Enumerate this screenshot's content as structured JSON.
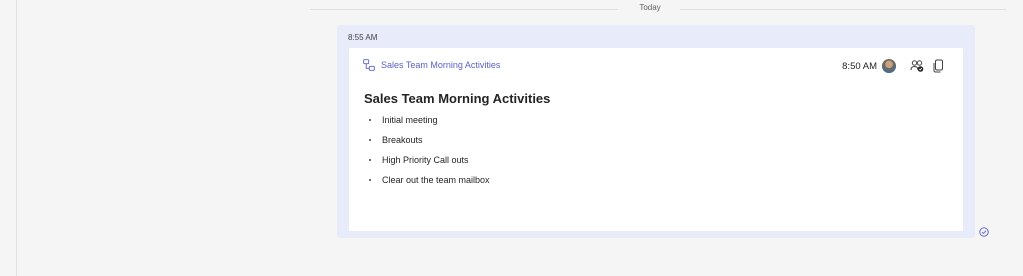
{
  "divider": {
    "label": "Today"
  },
  "message": {
    "time": "8:55 AM",
    "card": {
      "loop_title": "Sales Team Morning Activities",
      "header_time": "8:50 AM",
      "heading": "Sales Team Morning Activities",
      "items": [
        "Initial meeting",
        "Breakouts",
        "High Priority Call outs",
        "Clear out the team mailbox"
      ]
    }
  },
  "icons": {
    "loop": "loop-component-icon",
    "avatar": "user-avatar",
    "people": "people-icon",
    "copy": "copy-icon",
    "read": "read-receipt-icon"
  },
  "colors": {
    "accent": "#5b5fc7",
    "message_bg": "#e8ebfa",
    "card_bg": "#ffffff",
    "page_bg": "#f5f5f5"
  }
}
